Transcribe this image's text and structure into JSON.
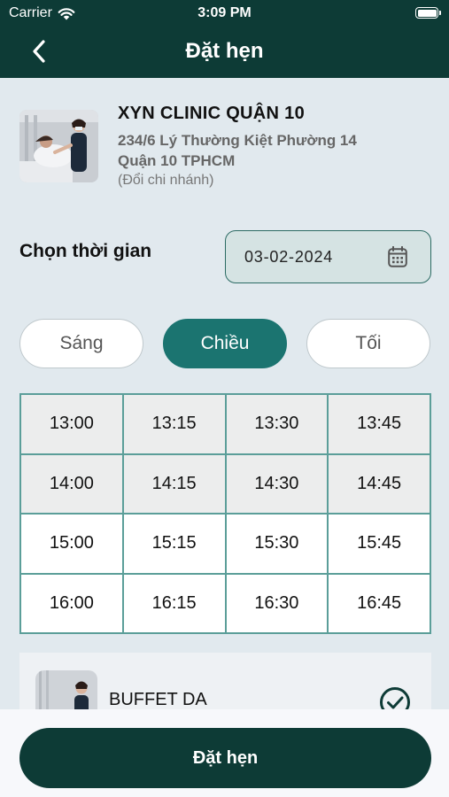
{
  "status_bar": {
    "carrier": "Carrier",
    "time": "3:09 PM"
  },
  "header": {
    "title": "Đặt hẹn"
  },
  "clinic": {
    "name": "XYN CLINIC QUẬN 10",
    "address_line1": "234/6 Lý Thường Kiệt Phường 14",
    "address_line2": "Quận 10 TPHCM",
    "change_branch": "(Đổi chi nhánh)"
  },
  "time_section": {
    "label": "Chọn thời gian",
    "date": "03-02-2024"
  },
  "periods": [
    {
      "label": "Sáng",
      "active": false
    },
    {
      "label": "Chiều",
      "active": true
    },
    {
      "label": "Tối",
      "active": false
    }
  ],
  "slots": [
    "13:00",
    "13:15",
    "13:30",
    "13:45",
    "14:00",
    "14:15",
    "14:30",
    "14:45",
    "15:00",
    "15:15",
    "15:30",
    "15:45",
    "16:00",
    "16:15",
    "16:30",
    "16:45"
  ],
  "service": {
    "name": "BUFFET DA",
    "selected": true
  },
  "footer": {
    "book_button": "Đặt hẹn"
  },
  "colors": {
    "primary_dark": "#0d3b36",
    "accent_teal": "#1b7470",
    "grid_border": "#5b9e99",
    "background": "#e1e9ee"
  }
}
